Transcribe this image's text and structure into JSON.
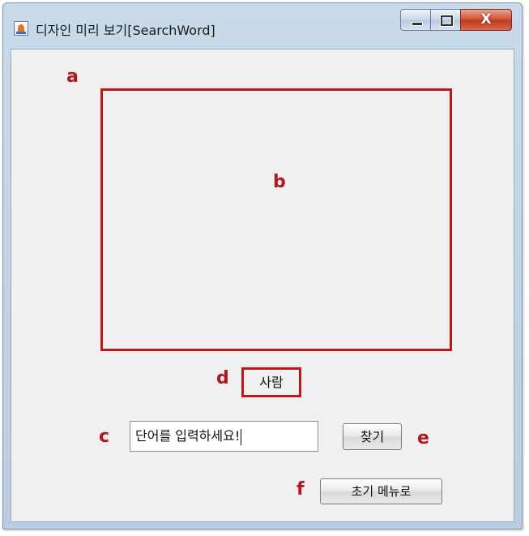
{
  "window": {
    "title": "디자인 미리 보기[SearchWord]",
    "close_glyph": "X"
  },
  "annotations": {
    "a": "a",
    "b": "b",
    "c": "c",
    "d": "d",
    "e": "e",
    "f": "f"
  },
  "main": {
    "word_label": "사람",
    "input_value": "단어를 입력하세요!",
    "find_button": "찾기",
    "menu_button": "초기 메뉴로"
  },
  "colors": {
    "annotation_red": "#b5161b",
    "client_bg": "#f0f0f0",
    "close_button": "#c03a1f"
  },
  "icons": {
    "app": "java-app-icon",
    "minimize": "minimize-icon",
    "maximize": "maximize-icon",
    "close": "close-icon"
  }
}
